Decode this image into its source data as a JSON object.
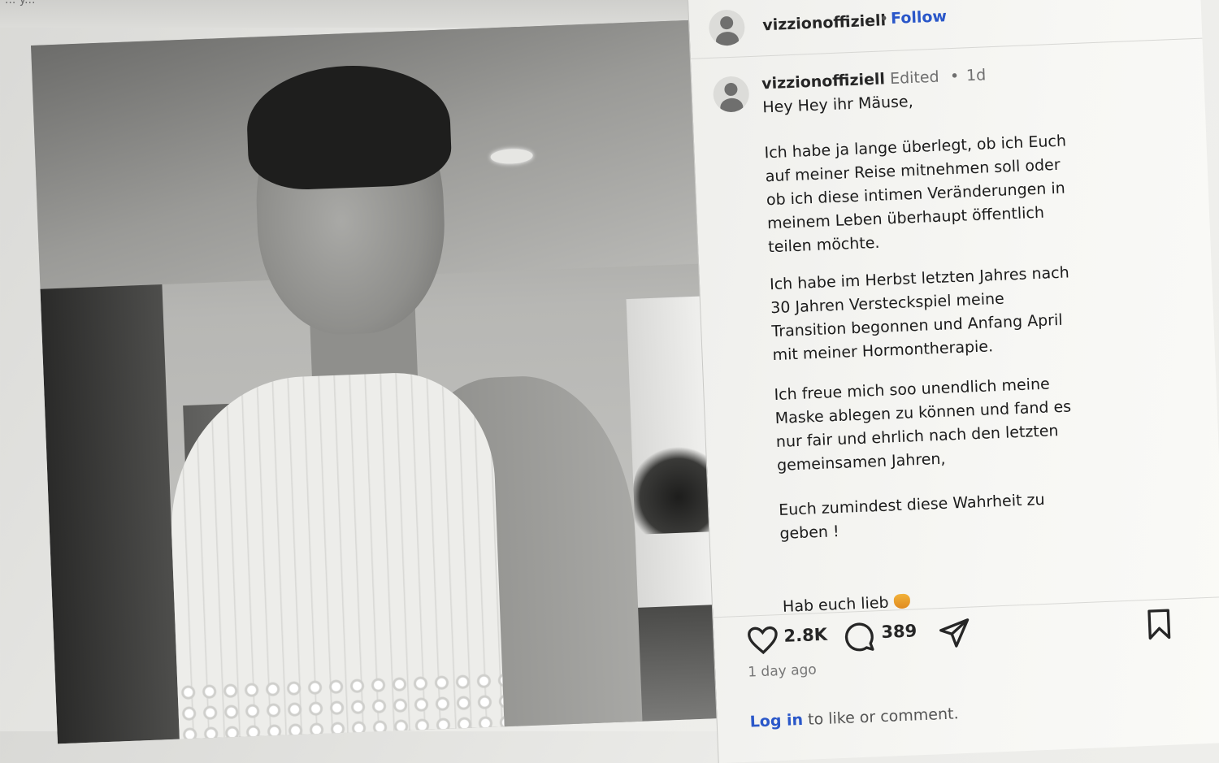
{
  "window": {
    "top_fragment": "... y..."
  },
  "post": {
    "header": {
      "username": "vizzionoffiziell",
      "separator": "•",
      "follow_label": "Follow"
    },
    "caption": {
      "username": "vizzionoffiziell",
      "edited": "Edited",
      "separator": "•",
      "time_short": "1d",
      "lines": [
        "Hey Hey ihr Mäuse,",
        "Ich habe ja lange überlegt, ob ich Euch\nauf meiner Reise mitnehmen soll oder\nob ich diese intimen Veränderungen in\nmeinem Leben überhaupt öffentlich\nteilen möchte.",
        "Ich habe im Herbst letzten Jahres nach\n30 Jahren Versteckspiel meine\nTransition begonnen und Anfang April\nmit meiner Hormontherapie.",
        "Ich freue mich soo unendlich meine\nMaske ablegen zu können und fand es\nnur fair und ehrlich nach den letzten\ngemeinsamen Jahren,",
        "Euch zumindest diese Wahrheit zu\ngeben !",
        "Hab euch lieb"
      ]
    },
    "actions": {
      "likes": "2.8K",
      "comments": "389"
    },
    "time_long": "1 day ago",
    "login_link": "Log in",
    "login_rest": " to like or comment."
  },
  "icons": {
    "heart": "heart-icon",
    "comment": "comment-icon",
    "share": "share-icon",
    "bookmark": "bookmark-icon",
    "avatar": "avatar-icon"
  }
}
